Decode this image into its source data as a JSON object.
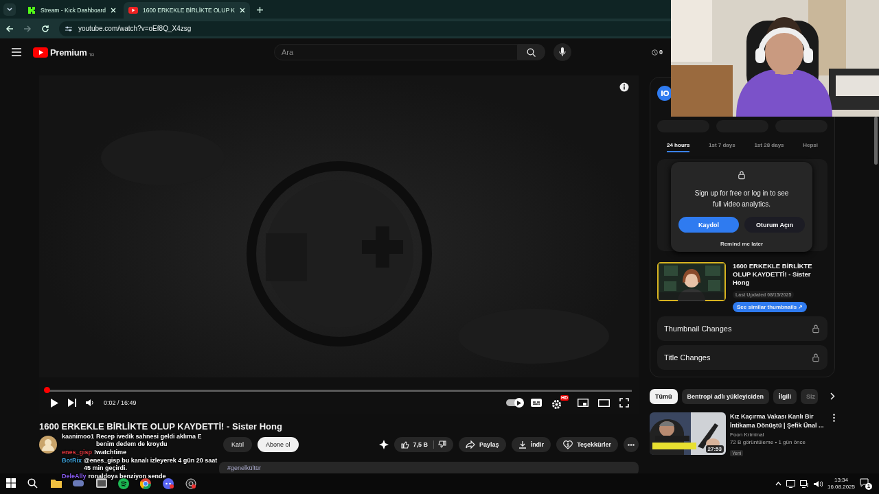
{
  "browser": {
    "tabs": [
      {
        "title": "Stream - Kick Dashboard",
        "kind": "kick",
        "selected": false
      },
      {
        "title": "1600 ERKEKLE BİRLİKTE OLUP K",
        "kind": "youtube",
        "selected": true
      }
    ],
    "url": "youtube.com/watch?v=oEf8Q_X4zsg"
  },
  "header": {
    "logo": "Premium",
    "region": "TR",
    "search": {
      "placeholder": "Ara"
    },
    "counter": "0"
  },
  "player": {
    "progress": {
      "level": 0.002
    },
    "time": "0:02 / 16:49",
    "autoplay": {
      "on": true
    },
    "quality_badge": "HD"
  },
  "video": {
    "title": "1600 ERKEKLE BİRLİKTE OLUP KAYDETTİ! - Sister Hong",
    "channel_buttons": [
      "Katıl",
      "Abone ol"
    ],
    "likes": "7,5 B",
    "actions": [
      {
        "kind": "share",
        "label": "Paylaş"
      },
      {
        "kind": "download",
        "label": "İndir"
      },
      {
        "kind": "thanks",
        "label": "Teşekkürler"
      }
    ],
    "description_tag": "#genelkültür"
  },
  "analytics": {
    "range_tabs": [
      {
        "label": "24 hours",
        "selected": true
      },
      {
        "label": "1st 7 days",
        "selected": false
      },
      {
        "label": "1st 28 days",
        "selected": false
      },
      {
        "label": "Hepsi",
        "selected": false
      }
    ],
    "lock_prompt": {
      "text": "Sign up for free or log in to see full video analytics.",
      "primary": "Kaydol",
      "secondary": "Oturum Açın",
      "dismiss": "Remind me later"
    },
    "video": {
      "title": "1600 ERKEKLE BİRLİKTE OLUP KAYDETTİ! - Sister Hong",
      "updated": "Last Updated 08/15/2025",
      "similar": "See similar thumbnails ↗"
    },
    "locked_sections": [
      "Thumbnail Changes",
      "Title Changes"
    ]
  },
  "chips": [
    {
      "label": "Tümü",
      "selected": true
    },
    {
      "label": "Bentropi adlı yükleyiciden",
      "selected": false
    },
    {
      "label": "İlgili",
      "selected": false
    },
    {
      "label": "Siz",
      "selected": false
    }
  ],
  "recommendations": [
    {
      "title": "Kız Kaçırma Vakası Kanlı Bir İntikama Dönüştü | Şefik Ünal ...",
      "channel": "Foon Kriminal",
      "meta": "72 B görüntüleme • 1 gün önce",
      "badge": "Yeni",
      "duration": "27:53"
    }
  ],
  "chat_overlay": [
    {
      "user": "kaanimoo1",
      "color": "#f2f2f2",
      "message": "Recep ivedik sahnesi geldi aklıma E benim dedem de kroydu"
    },
    {
      "user": "enes_gisp",
      "color": "#e0383e",
      "message": "!watchtime"
    },
    {
      "user": "BotRix",
      "color": "#3fa7e0",
      "message": "@enes_gisp bu kanalı izleyerek 4 gün 20 saat 45 min geçirdi."
    },
    {
      "user": "DeleAlly",
      "color": "#8b5cf6",
      "message": "ronaldoya benziyon sende"
    }
  ],
  "taskbar": {
    "time": "13:34",
    "date": "16.08.2025",
    "notifications": "1"
  }
}
